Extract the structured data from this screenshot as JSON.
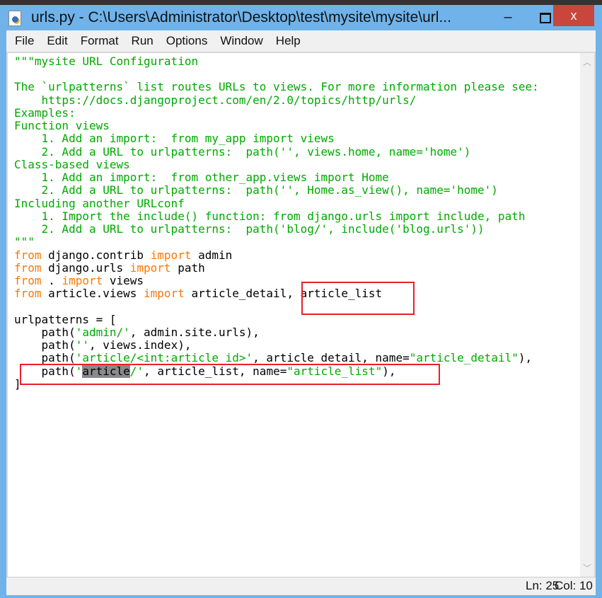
{
  "window": {
    "title": "urls.py - C:\\Users\\Administrator\\Desktop\\test\\mysite\\mysite\\url...",
    "minimize": "–",
    "close": "x"
  },
  "menu": [
    "File",
    "Edit",
    "Format",
    "Run",
    "Options",
    "Window",
    "Help"
  ],
  "code_lines": [
    [
      {
        "t": "\"\"\"mysite URL Configuration",
        "c": "str"
      }
    ],
    [],
    [
      {
        "t": "The `urlpatterns` list routes URLs to views. For more information please see:",
        "c": "str"
      }
    ],
    [
      {
        "t": "    https://docs.djangoproject.com/en/2.0/topics/http/urls/",
        "c": "str"
      }
    ],
    [
      {
        "t": "Examples:",
        "c": "str"
      }
    ],
    [
      {
        "t": "Function views",
        "c": "str"
      }
    ],
    [
      {
        "t": "    1. Add an import:  from my_app import views",
        "c": "str"
      }
    ],
    [
      {
        "t": "    2. Add a URL to urlpatterns:  path('', views.home, name='home')",
        "c": "str"
      }
    ],
    [
      {
        "t": "Class-based views",
        "c": "str"
      }
    ],
    [
      {
        "t": "    1. Add an import:  from other_app.views import Home",
        "c": "str"
      }
    ],
    [
      {
        "t": "    2. Add a URL to urlpatterns:  path('', Home.as_view(), name='home')",
        "c": "str"
      }
    ],
    [
      {
        "t": "Including another URLconf",
        "c": "str"
      }
    ],
    [
      {
        "t": "    1. Import the include() function: from django.urls import include, path",
        "c": "str"
      }
    ],
    [
      {
        "t": "    2. Add a URL to urlpatterns:  path('blog/', include('blog.urls'))",
        "c": "str"
      }
    ],
    [
      {
        "t": "\"\"\"",
        "c": "str"
      }
    ],
    [
      {
        "t": "from",
        "c": "kw"
      },
      {
        "t": " django.contrib ",
        "c": ""
      },
      {
        "t": "import",
        "c": "kw"
      },
      {
        "t": " admin",
        "c": ""
      }
    ],
    [
      {
        "t": "from",
        "c": "kw"
      },
      {
        "t": " django.urls ",
        "c": ""
      },
      {
        "t": "import",
        "c": "kw"
      },
      {
        "t": " path",
        "c": ""
      }
    ],
    [
      {
        "t": "from",
        "c": "kw"
      },
      {
        "t": " . ",
        "c": ""
      },
      {
        "t": "import",
        "c": "kw"
      },
      {
        "t": " views",
        "c": ""
      }
    ],
    [
      {
        "t": "from",
        "c": "kw"
      },
      {
        "t": " article.views ",
        "c": ""
      },
      {
        "t": "import",
        "c": "kw"
      },
      {
        "t": " article_detail, article_list",
        "c": ""
      }
    ],
    [],
    [
      {
        "t": "urlpatterns = [",
        "c": ""
      }
    ],
    [
      {
        "t": "    path(",
        "c": ""
      },
      {
        "t": "'admin/'",
        "c": "str"
      },
      {
        "t": ", admin.site.urls),",
        "c": ""
      }
    ],
    [
      {
        "t": "    path(",
        "c": ""
      },
      {
        "t": "''",
        "c": "str"
      },
      {
        "t": ", views.index),",
        "c": ""
      }
    ],
    [
      {
        "t": "    path(",
        "c": ""
      },
      {
        "t": "'article/<int:article_id>'",
        "c": "str"
      },
      {
        "t": ", article_detail, name=",
        "c": ""
      },
      {
        "t": "\"article_detail\"",
        "c": "str"
      },
      {
        "t": "),",
        "c": ""
      }
    ],
    [
      {
        "t": "    path(",
        "c": ""
      },
      {
        "t": "'",
        "c": "str"
      },
      {
        "t": "article",
        "c": "sel"
      },
      {
        "t": "/'",
        "c": "str"
      },
      {
        "t": ", article_list, name=",
        "c": ""
      },
      {
        "t": "\"article_list\"",
        "c": "str"
      },
      {
        "t": "),",
        "c": ""
      }
    ],
    [
      {
        "t": "]",
        "c": ""
      }
    ]
  ],
  "status": {
    "line": "Ln: 25",
    "col": "Col: 10"
  },
  "colors": {
    "keyword": "#ff7700",
    "string": "#00aa00",
    "highlight_box": "#e8202a",
    "titlebar": "#6fb3ea"
  }
}
